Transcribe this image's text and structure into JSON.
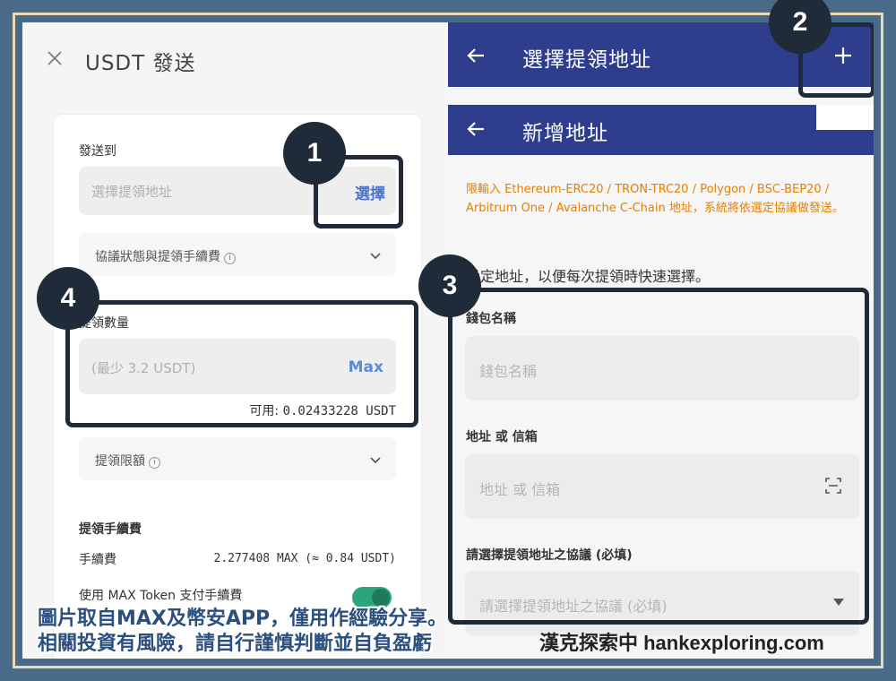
{
  "left": {
    "title": "USDT 發送",
    "send_to_label": "發送到",
    "address_placeholder": "選擇提領地址",
    "select_button": "選擇",
    "protocol_fee_accordion": "協議狀態與提領手續費",
    "amount_label": "提領數量",
    "amount_placeholder": "(最少 3.2 USDT)",
    "max_button": "Max",
    "available_label": "可用:",
    "available_value": "0.02433228 USDT",
    "limit_accordion": "提領限額",
    "fee_section_label": "提領手續費",
    "fee_label": "手續費",
    "fee_value": "2.277408 MAX (≈ 0.84 USDT)",
    "max_token_label": "使用 MAX Token 支付手續費"
  },
  "right": {
    "top_title": "選擇提領地址",
    "sub_title": "新增地址",
    "warning": "限輸入 Ethereum-ERC20 / TRON-TRC20 / Polygon / BSC-BEP20 / Arbitrum One / Avalanche C-Chain 地址，系統將依選定協議做發送。",
    "hint": "設定地址，以便每次提領時快速選擇。",
    "wallet_name_label": "錢包名稱",
    "wallet_name_placeholder": "錢包名稱",
    "address_label": "地址 或 信箱",
    "address_placeholder": "地址 或 信箱",
    "protocol_label": "請選擇提領地址之協議 (必填)",
    "protocol_placeholder": "請選擇提領地址之協議 (必填)"
  },
  "badges": [
    "1",
    "2",
    "3",
    "4"
  ],
  "footer": {
    "line1": "圖片取自MAX及幣安APP，僅用作經驗分享。",
    "line2": "相關投資有風險，請自行謹慎判斷並自負盈虧",
    "brand": "漢克探索中 hankexploring.com"
  },
  "colors": {
    "header": "#2f3e8c",
    "accent_blue": "#4a74c9",
    "warning_orange": "#e67e00",
    "highlight": "#1f2b38",
    "frame_bg": "#4a6b87"
  }
}
